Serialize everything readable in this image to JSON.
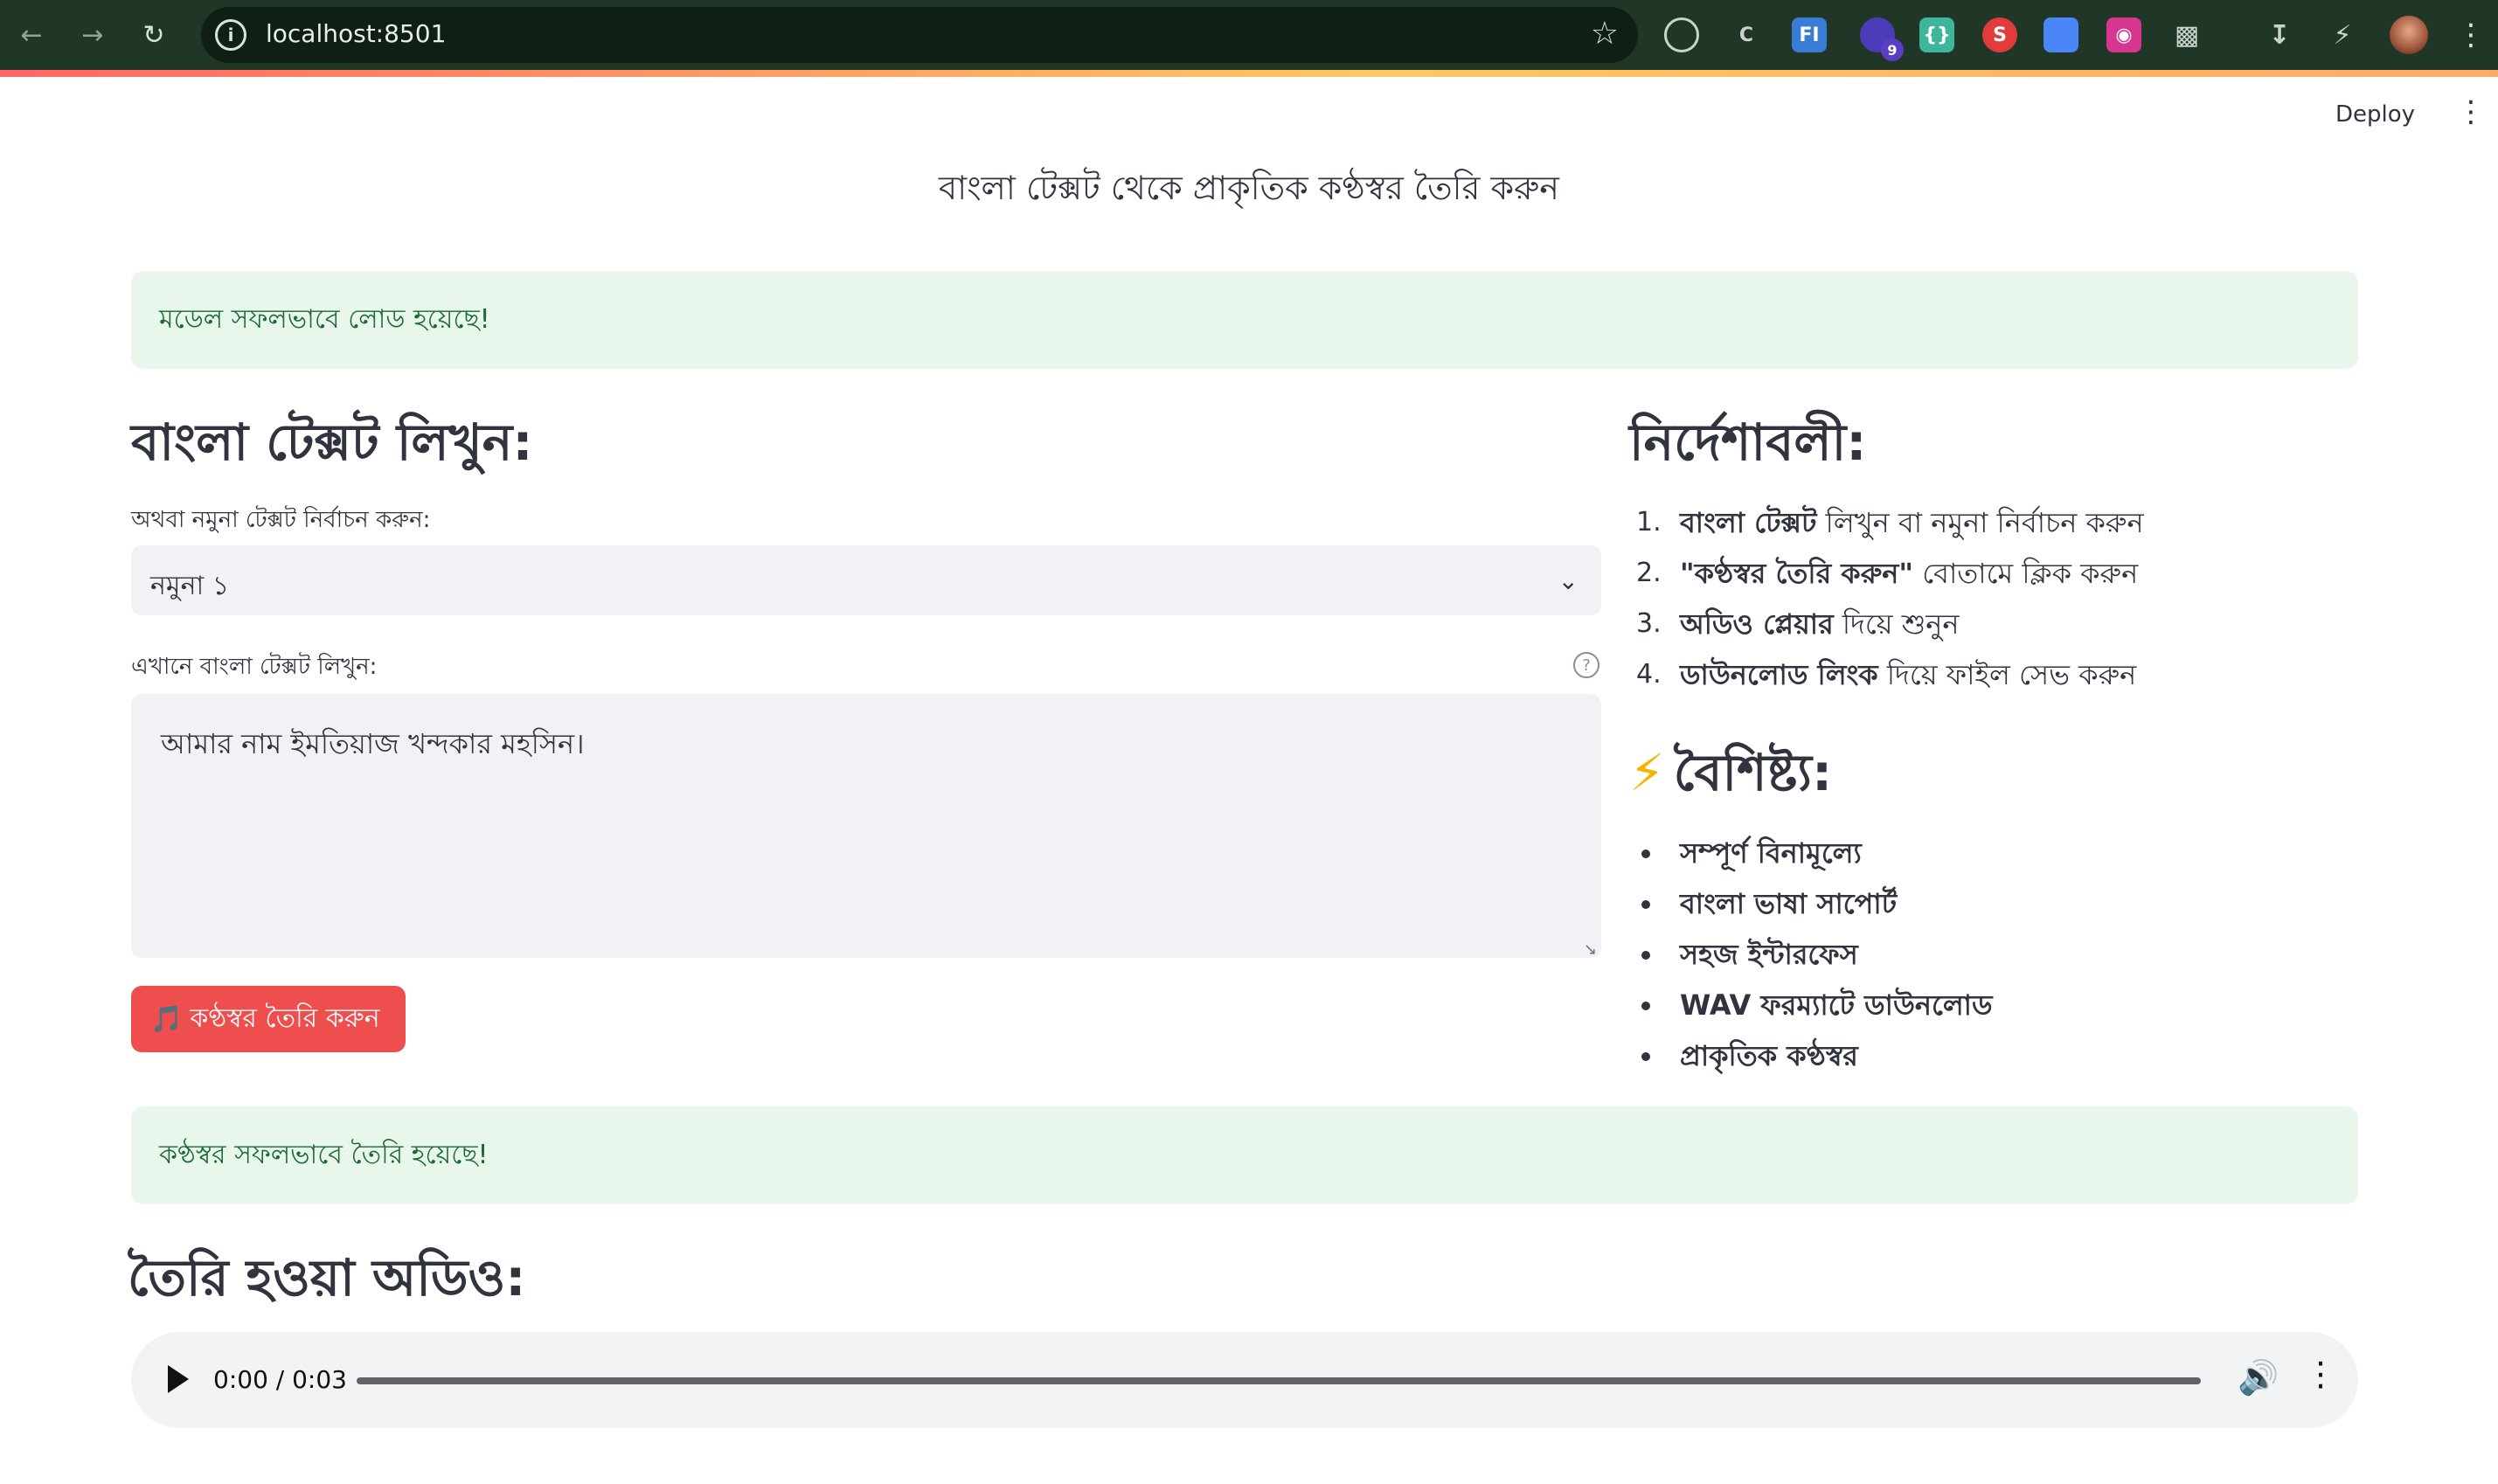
{
  "browser": {
    "url": "localhost:8501",
    "extension_badge": "9",
    "extensions": [
      "target-icon",
      "code-icon",
      "fi-icon",
      "hexagon-icon",
      "braces-icon",
      "shield-s-icon",
      "docs-icon",
      "instagram-icon",
      "puzzle-icon"
    ]
  },
  "app_header": {
    "deploy_label": "Deploy"
  },
  "page_title": "বাংলা টেক্সট থেকে প্রাকৃতিক কণ্ঠস্বর তৈরি করুন",
  "alerts": {
    "model_loaded": "মডেল সফলভাবে লোড হয়েছে!",
    "voice_created": "কণ্ঠস্বর সফলভাবে তৈরি হয়েছে!"
  },
  "input_section": {
    "heading": "বাংলা টেক্সট লিখুন:",
    "select_label": "অথবা নমুনা টেক্সট নির্বাচন করুন:",
    "select_value": "নমুনা ১",
    "textarea_label": "এখানে বাংলা টেক্সট লিখুন:",
    "textarea_value": "আমার নাম ইমতিয়াজ খন্দকার মহসিন।",
    "generate_button": "কণ্ঠস্বর তৈরি করুন",
    "generate_icon": "🎵"
  },
  "instructions": {
    "heading": "নির্দেশাবলী:",
    "items": [
      {
        "num": "1.",
        "bold": "বাংলা টেক্সট",
        "rest": " লিখুন বা নমুনা নির্বাচন করুন"
      },
      {
        "num": "2.",
        "bold": "\"কণ্ঠস্বর তৈরি করুন\"",
        "rest": " বোতামে ক্লিক করুন"
      },
      {
        "num": "3.",
        "bold": "অডিও প্লেয়ার",
        "rest": " দিয়ে শুনুন"
      },
      {
        "num": "4.",
        "bold": "ডাউনলোড লিংক",
        "rest": " দিয়ে ফাইল সেভ করুন"
      }
    ]
  },
  "features": {
    "icon": "⚡",
    "heading": "বৈশিষ্ট্য:",
    "items": [
      "সম্পূর্ণ বিনামূল্যে",
      "বাংলা ভাষা সাপোর্ট",
      "সহজ ইন্টারফেস",
      "WAV ফরম্যাটে ডাউনলোড",
      "প্রাকৃতিক কণ্ঠস্বর"
    ]
  },
  "audio_section": {
    "heading": "তৈরি হওয়া অডিও:",
    "time_display": "0:00 / 0:03",
    "progress_fraction": 0
  }
}
